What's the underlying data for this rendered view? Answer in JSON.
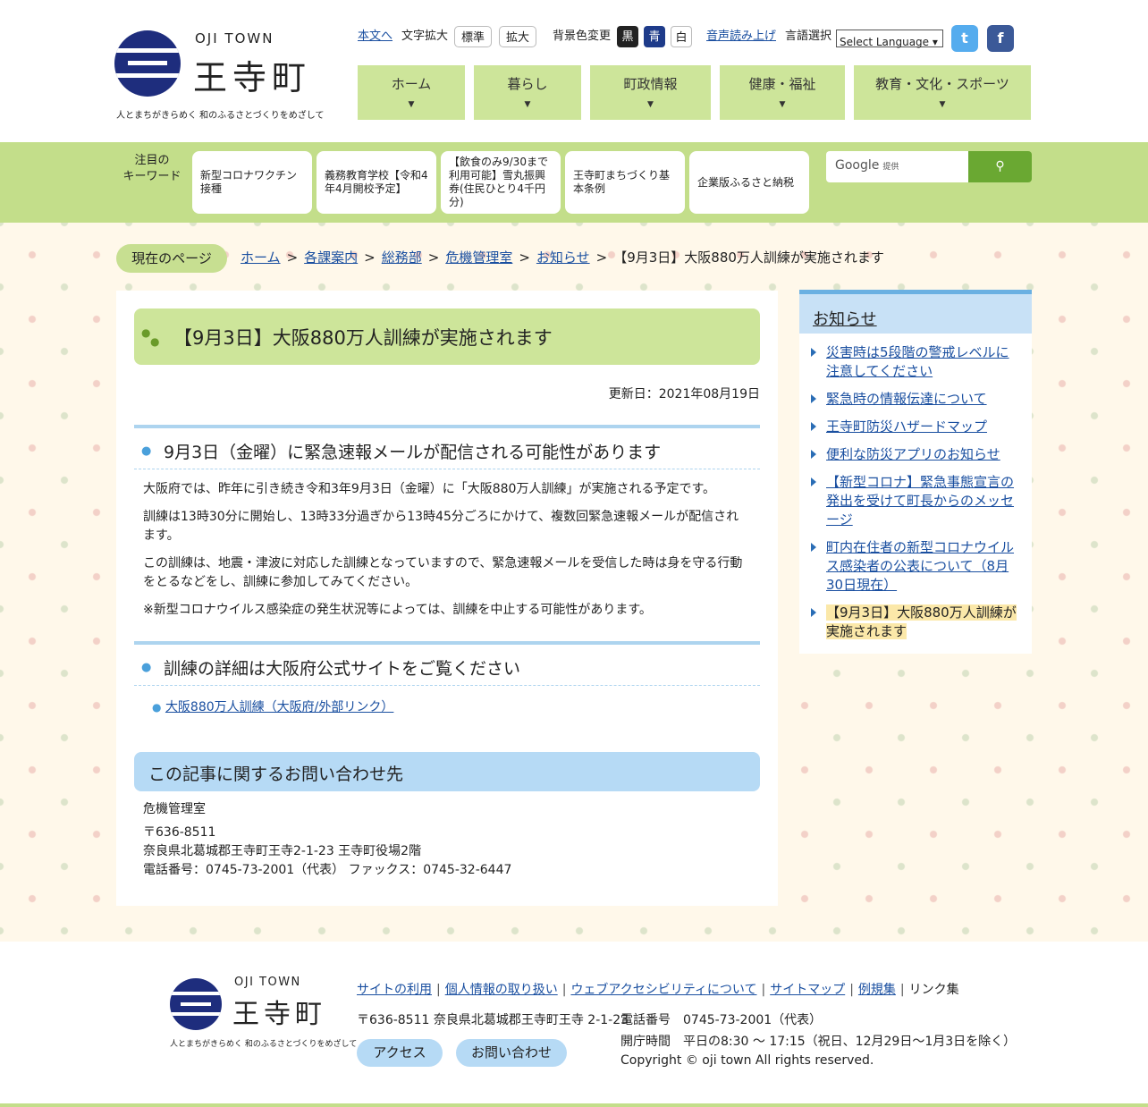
{
  "header": {
    "logo_en": "OJI TOWN",
    "logo_ja": "王寺町",
    "tagline": "人とまちがきらめく 和のふるさとづくりをめざして",
    "skip_link": "本文へ",
    "font_size_label": "文字拡大",
    "font_standard": "標準",
    "font_large": "拡大",
    "bg_color_label": "背景色変更",
    "bg_black": "黒",
    "bg_blue": "青",
    "bg_white": "白",
    "voice_read": "音声読み上げ",
    "lang_label": "言語選択",
    "lang_select": "Select Language",
    "twitter_glyph": "t",
    "facebook_glyph": "f"
  },
  "nav": [
    "ホーム",
    "暮らし",
    "町政情報",
    "健康・福祉",
    "教育・文化・スポーツ"
  ],
  "keywords": {
    "label_line1": "注目の",
    "label_line2": "キーワード",
    "items": [
      "新型コロナワクチン接種",
      "義務教育学校【令和4年4月開校予定】",
      "【飲食のみ9/30まで利用可能】雪丸振興券(住民ひとり4千円分)",
      "王寺町まちづくり基本条例",
      "企業版ふるさと納税"
    ]
  },
  "search": {
    "provider": "Google",
    "provider_sub": "提供",
    "button_icon": "search-icon"
  },
  "breadcrumb": {
    "current_label": "現在のページ",
    "items": [
      "ホーム",
      "各課案内",
      "総務部",
      "危機管理室",
      "お知らせ"
    ],
    "current": "【9月3日】大阪880万人訓練が実施されます"
  },
  "article": {
    "title": "【9月3日】大阪880万人訓練が実施されます",
    "updated": "更新日：2021年08月19日",
    "section1_title": "9月3日（金曜）に緊急速報メールが配信される可能性があります",
    "paragraphs": [
      "大阪府では、昨年に引き続き令和3年9月3日（金曜）に「大阪880万人訓練」が実施される予定です。",
      "訓練は13時30分に開始し、13時33分過ぎから13時45分ごろにかけて、複数回緊急速報メールが配信されます。",
      "この訓練は、地震・津波に対応した訓練となっていますので、緊急速報メールを受信した時は身を守る行動をとるなどをし、訓練に参加してみてください。",
      "※新型コロナウイルス感染症の発生状況等によっては、訓練を中止する可能性があります。"
    ],
    "section2_title": "訓練の詳細は大阪府公式サイトをご覧ください",
    "external_link": "大阪880万人訓練（大阪府/外部リンク）",
    "inquiry_title": "この記事に関するお問い合わせ先",
    "dept": "危機管理室",
    "postal": "〒636-8511",
    "address": "奈良県北葛城郡王寺町王寺2-1-23 王寺町役場2階",
    "phone": "電話番号：0745-73-2001（代表） ファックス：0745-32-6447"
  },
  "sidebar": {
    "title": "お知らせ",
    "items": [
      "災害時は5段階の警戒レベルに注意してください",
      "緊急時の情報伝達について",
      "王寺町防災ハザードマップ",
      "便利な防災アプリのお知らせ",
      "【新型コロナ】緊急事態宣言の発出を受けて町長からのメッセージ",
      "町内在住者の新型コロナウイルス感染者の公表について（8月30日現在）",
      "【9月3日】大阪880万人訓練が実施されます"
    ]
  },
  "footer": {
    "logo_en": "OJI TOWN",
    "logo_ja": "王寺町",
    "tagline": "人とまちがきらめく 和のふるさとづくりをめざして",
    "links": [
      "サイトの利用",
      "個人情報の取り扱い",
      "ウェブアクセシビリティについて",
      "サイトマップ",
      "例規集",
      "リンク集"
    ],
    "address": "〒636-8511 奈良県北葛城郡王寺町王寺 2-1-23",
    "access": "アクセス",
    "contact": "お問い合わせ",
    "phone": "電話番号　0745-73-2001（代表）",
    "hours": "開庁時間　平日の8:30 〜 17:15（祝日、12月29日〜1月3日を除く）",
    "copyright": "Copyright © oji town All rights reserved."
  },
  "colors": {
    "nav_green": "#cde59a",
    "band_green": "#c3de8a",
    "blue_accent": "#b6daf5",
    "logo_navy": "#1e2d7d"
  }
}
